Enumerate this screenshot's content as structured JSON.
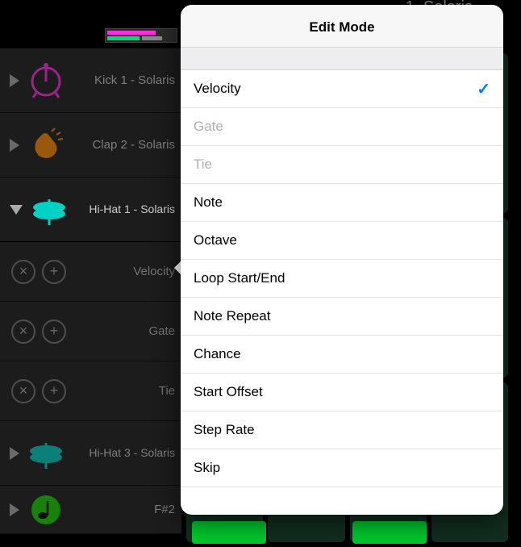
{
  "header": {
    "title_partial": "1. Solaris"
  },
  "tracks": [
    {
      "label": "Kick 1 - Solaris",
      "icon": "kick",
      "color": "#ff2de0",
      "expanded": false
    },
    {
      "label": "Clap 2 - Solaris",
      "icon": "clap",
      "color": "#ff8a00",
      "expanded": false
    },
    {
      "label": "Hi-Hat 1 - Solaris",
      "icon": "hihat",
      "color": "#00d1c5",
      "expanded": true
    },
    {
      "label": "Hi-Hat 3 - Solaris",
      "icon": "hihat",
      "color": "#00d1c5",
      "expanded": false
    },
    {
      "label": "F#2",
      "icon": "note",
      "color": "#14d400",
      "expanded": false
    }
  ],
  "sub_rows": [
    {
      "label": "Velocity"
    },
    {
      "label": "Gate"
    },
    {
      "label": "Tie"
    }
  ],
  "popover": {
    "title": "Edit Mode",
    "items": [
      {
        "label": "Velocity",
        "selected": true,
        "disabled": false
      },
      {
        "label": "Gate",
        "selected": false,
        "disabled": true
      },
      {
        "label": "Tie",
        "selected": false,
        "disabled": true
      },
      {
        "label": "Note",
        "selected": false,
        "disabled": false
      },
      {
        "label": "Octave",
        "selected": false,
        "disabled": false
      },
      {
        "label": "Loop Start/End",
        "selected": false,
        "disabled": false
      },
      {
        "label": "Note Repeat",
        "selected": false,
        "disabled": false
      },
      {
        "label": "Chance",
        "selected": false,
        "disabled": false
      },
      {
        "label": "Start Offset",
        "selected": false,
        "disabled": false
      },
      {
        "label": "Step Rate",
        "selected": false,
        "disabled": false
      },
      {
        "label": "Skip",
        "selected": false,
        "disabled": false
      }
    ]
  }
}
